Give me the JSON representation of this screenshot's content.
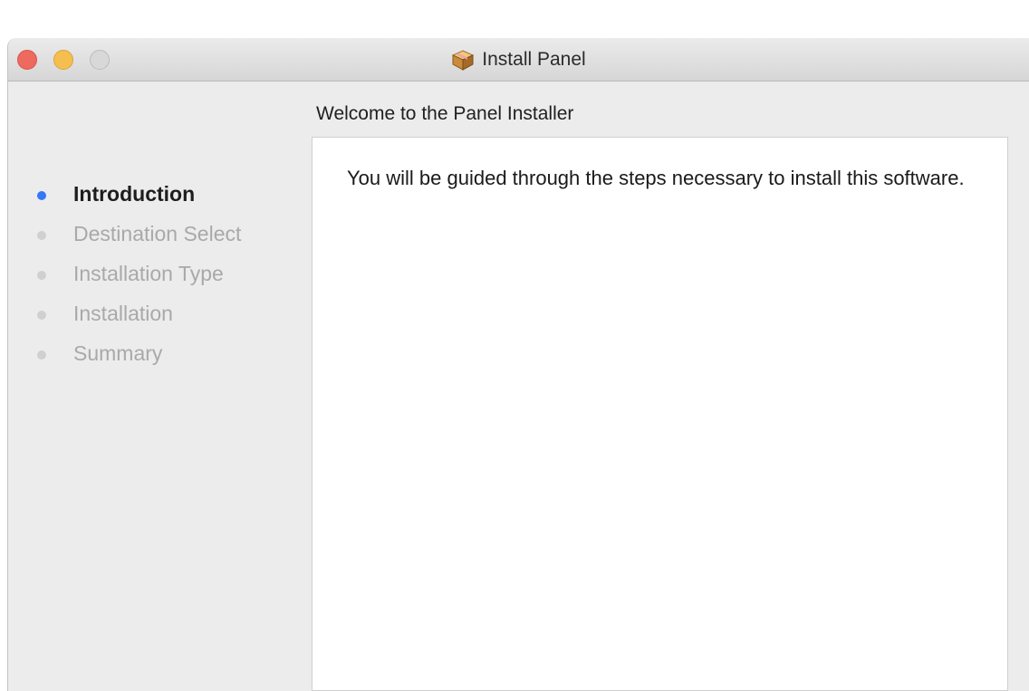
{
  "window": {
    "title": "Install Panel",
    "title_icon": "package-icon"
  },
  "traffic_lights": {
    "close_color": "#ee6a5e",
    "minimize_color": "#f5bf4f",
    "zoom_color": "#d8d8d8"
  },
  "header": {
    "title": "Welcome to the Panel Installer"
  },
  "steps": [
    {
      "label": "Introduction",
      "active": true
    },
    {
      "label": "Destination Select",
      "active": false
    },
    {
      "label": "Installation Type",
      "active": false
    },
    {
      "label": "Installation",
      "active": false
    },
    {
      "label": "Summary",
      "active": false
    }
  ],
  "content": {
    "body": "You will be guided through the steps necessary to install this software."
  },
  "colors": {
    "accent": "#3478f6",
    "inactive_step": "#a9a9a9"
  }
}
